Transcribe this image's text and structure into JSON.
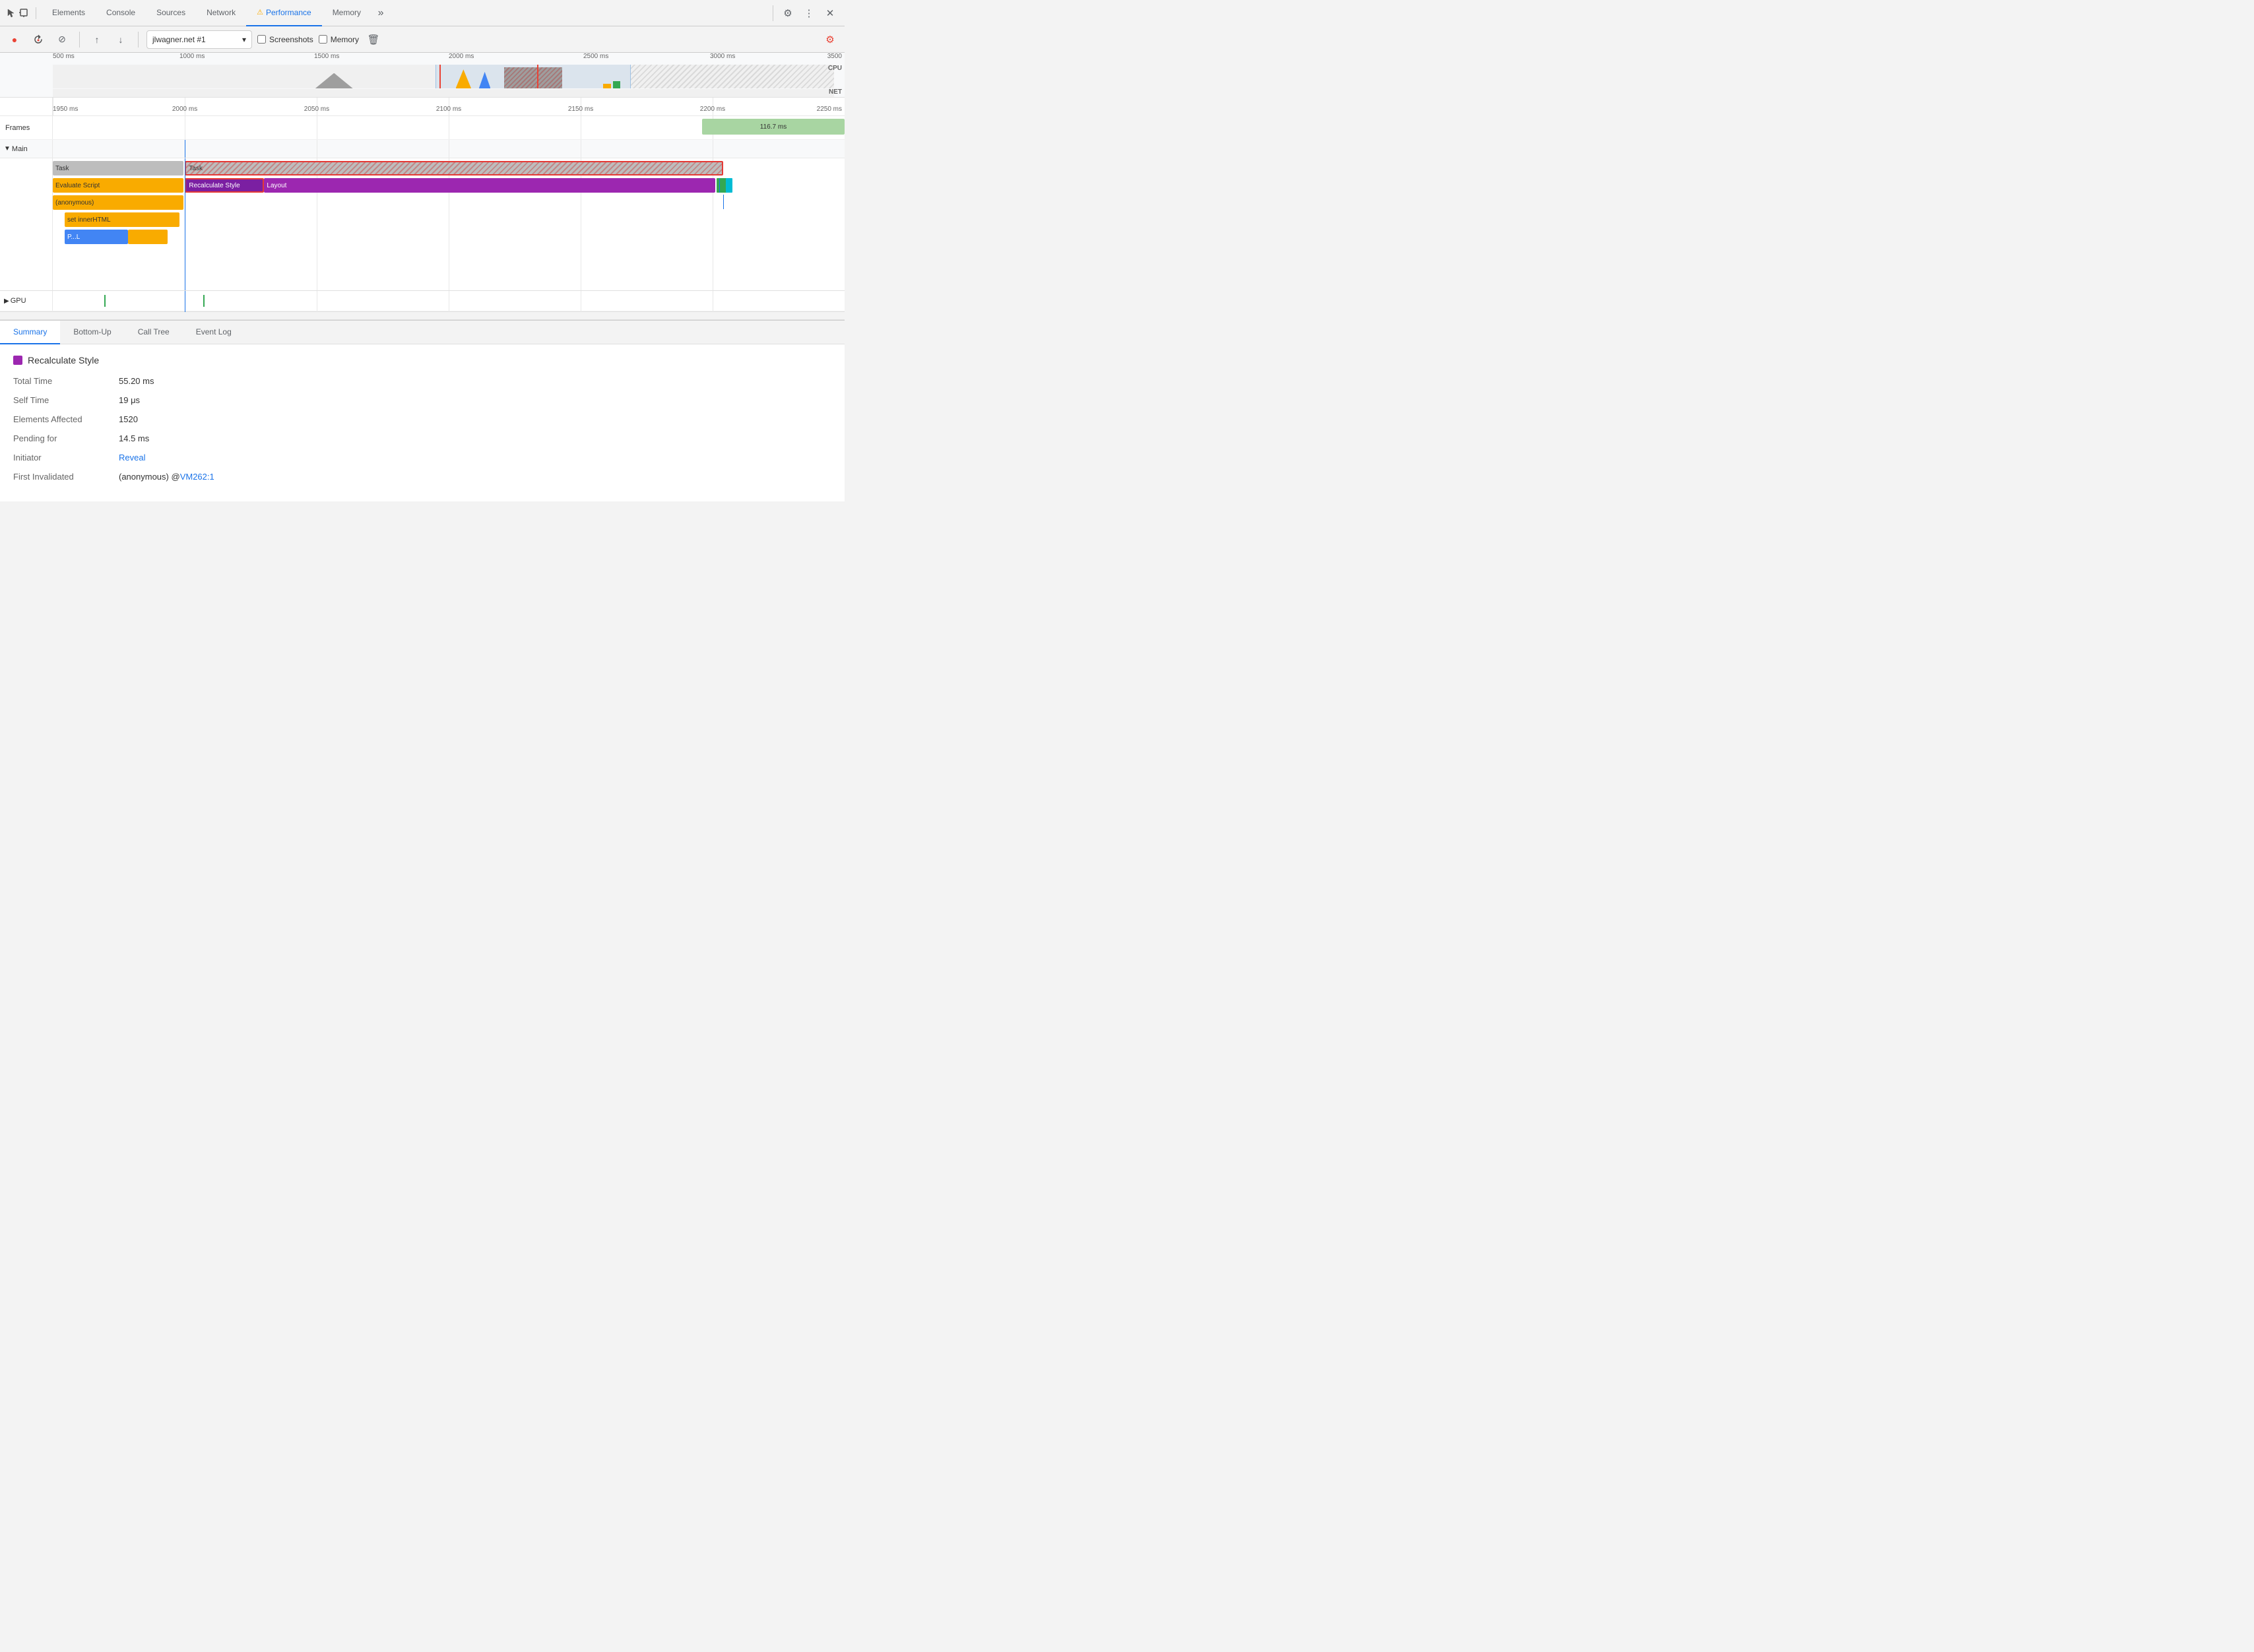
{
  "devtools": {
    "tabs": [
      {
        "id": "elements",
        "label": "Elements",
        "active": false
      },
      {
        "id": "console",
        "label": "Console",
        "active": false
      },
      {
        "id": "sources",
        "label": "Sources",
        "active": false
      },
      {
        "id": "network",
        "label": "Network",
        "active": false
      },
      {
        "id": "performance",
        "label": "Performance",
        "active": true,
        "warn": true
      },
      {
        "id": "memory",
        "label": "Memory",
        "active": false
      }
    ],
    "overflow_label": "»",
    "settings_label": "⚙",
    "more_label": "⋮",
    "close_label": "✕"
  },
  "perf_toolbar": {
    "record_label": "●",
    "reload_label": "↺",
    "clear_label": "⊘",
    "upload_label": "↑",
    "download_label": "↓",
    "profile_name": "jlwagner.net #1",
    "screenshots_label": "Screenshots",
    "memory_label": "Memory",
    "trash_label": "🗑"
  },
  "overview": {
    "ruler_labels": [
      "500 ms",
      "1000 ms",
      "1500 ms",
      "2000 ms",
      "2500 ms",
      "3000 ms",
      "3500"
    ],
    "cpu_label": "CPU",
    "net_label": "NET"
  },
  "timeline": {
    "ruler_labels": [
      "1950 ms",
      "2000 ms",
      "2050 ms",
      "2100 ms",
      "2150 ms",
      "2200 ms",
      "2250 ms"
    ],
    "frames_label": "Frames",
    "frame_value": "116.7 ms",
    "main_label": "Main",
    "gpu_label": "GPU",
    "tasks": [
      {
        "label": "Task",
        "type": "gray",
        "level": 0
      },
      {
        "label": "Task",
        "type": "gray-hatch",
        "level": 0
      },
      {
        "label": "Evaluate Script",
        "type": "yellow",
        "level": 1
      },
      {
        "label": "Recalculate Style",
        "type": "purple-outline",
        "level": 1
      },
      {
        "label": "Layout",
        "type": "purple",
        "level": 1
      },
      {
        "label": "(anonymous)",
        "type": "yellow",
        "level": 2
      },
      {
        "label": "set innerHTML",
        "type": "yellow",
        "level": 3
      },
      {
        "label": "P...L",
        "type": "blue",
        "level": 4
      }
    ]
  },
  "bottom_panel": {
    "tabs": [
      "Summary",
      "Bottom-Up",
      "Call Tree",
      "Event Log"
    ],
    "active_tab": "Summary",
    "summary": {
      "title": "Recalculate Style",
      "color": "#9c27b0",
      "rows": [
        {
          "key": "Total Time",
          "value": "55.20 ms",
          "type": "text"
        },
        {
          "key": "Self Time",
          "value": "19 μs",
          "type": "text"
        },
        {
          "key": "Elements Affected",
          "value": "1520",
          "type": "text"
        },
        {
          "key": "Pending for",
          "value": "14.5 ms",
          "type": "text"
        },
        {
          "key": "Initiator",
          "value": "Reveal",
          "type": "link"
        },
        {
          "key": "First Invalidated",
          "value": "(anonymous) @ VM262:1",
          "type": "link-value",
          "label": "(anonymous) @ ",
          "link": "VM262:1"
        }
      ]
    }
  }
}
